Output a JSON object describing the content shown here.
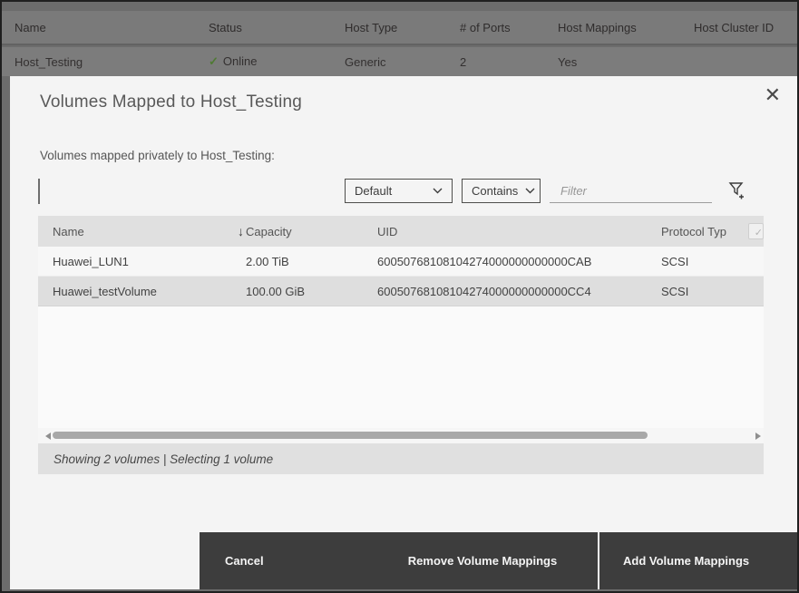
{
  "background_table": {
    "columns": [
      "Name",
      "Status",
      "Host Type",
      "# of Ports",
      "Host Mappings",
      "Host Cluster ID"
    ],
    "row": {
      "name": "Host_Testing",
      "status_icon": "✓",
      "status": "Online",
      "host_type": "Generic",
      "ports": "2",
      "host_mappings": "Yes"
    }
  },
  "modal": {
    "title": "Volumes Mapped to Host_Testing",
    "close_icon": "✕",
    "description": "Volumes mapped privately to Host_Testing:",
    "toolbar": {
      "scope_dropdown_value": "Default",
      "match_dropdown_value": "Contains",
      "filter_placeholder": "Filter"
    },
    "table": {
      "columns": {
        "name": "Name",
        "capacity": "Capacity",
        "uid": "UID",
        "protocol": "Protocol Typ"
      },
      "sort_icon": "↓",
      "rows": [
        {
          "name": "Huawei_LUN1",
          "capacity": "2.00 TiB",
          "uid": "60050768108104274000000000000CAB",
          "protocol": "SCSI"
        },
        {
          "name": "Huawei_testVolume",
          "capacity": "100.00 GiB",
          "uid": "60050768108104274000000000000CC4",
          "protocol": "SCSI"
        }
      ]
    },
    "status_bar": "Showing 2 volumes | Selecting 1 volume",
    "footer": {
      "cancel_label": "Cancel",
      "remove_label": "Remove Volume Mappings",
      "add_label": "Add Volume Mappings"
    }
  },
  "colors": {
    "footer_bg": "#3d3d3d",
    "selected_row": "#dedede",
    "table_header_bg": "#e0e0e0",
    "status_green": "#4f7a33",
    "dim_overlay": "#747474"
  }
}
